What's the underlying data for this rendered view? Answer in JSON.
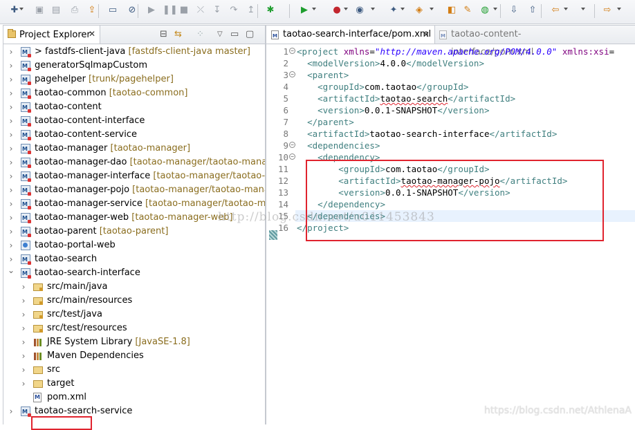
{
  "toolbar": {
    "icons": [
      "new-icon",
      "save-icon",
      "save-all-icon",
      "print-icon",
      "publish-icon",
      "console-icon",
      "skip-breakpoints-icon",
      "resume-icon",
      "suspend-icon",
      "terminate-icon",
      "disconnect-icon",
      "step-into-icon",
      "step-over-icon",
      "step-return-icon",
      "debug-icon",
      "run-icon",
      "run-external-icon",
      "coverage-icon",
      "new-java-class-icon",
      "open-type-icon",
      "open-task-icon",
      "search-icon",
      "web-browser-icon",
      "next-annotation-icon",
      "previous-annotation-icon",
      "back-icon",
      "forward-icon"
    ]
  },
  "project_explorer": {
    "title": "Project Explorer",
    "close": "✕",
    "items": [
      {
        "label": "> fastdfs-client-java",
        "decoration": "[fastdfs-client-java master]",
        "icon": "maven-project-icon",
        "expanded": false
      },
      {
        "label": "generatorSqlmapCustom",
        "decoration": "",
        "icon": "java-project-icon",
        "expanded": false
      },
      {
        "label": "pagehelper",
        "decoration": "[trunk/pagehelper]",
        "icon": "maven-project-icon",
        "expanded": false
      },
      {
        "label": "taotao-common",
        "decoration": "[taotao-common]",
        "icon": "maven-project-icon",
        "expanded": false
      },
      {
        "label": "taotao-content",
        "decoration": "",
        "icon": "maven-project-icon",
        "expanded": false
      },
      {
        "label": "taotao-content-interface",
        "decoration": "",
        "icon": "maven-project-icon",
        "expanded": false
      },
      {
        "label": "taotao-content-service",
        "decoration": "",
        "icon": "maven-project-icon",
        "expanded": false
      },
      {
        "label": "taotao-manager",
        "decoration": "[taotao-manager]",
        "icon": "maven-project-icon",
        "expanded": false
      },
      {
        "label": "taotao-manager-dao",
        "decoration": "[taotao-manager/taotao-manager-",
        "icon": "maven-project-icon",
        "expanded": false
      },
      {
        "label": "taotao-manager-interface",
        "decoration": "[taotao-manager/taotao-mana",
        "icon": "maven-project-icon",
        "expanded": false
      },
      {
        "label": "taotao-manager-pojo",
        "decoration": "[taotao-manager/taotao-manager",
        "icon": "maven-project-icon",
        "expanded": false
      },
      {
        "label": "taotao-manager-service",
        "decoration": "[taotao-manager/taotao-manag",
        "icon": "maven-project-icon",
        "expanded": false
      },
      {
        "label": "taotao-manager-web",
        "decoration": "[taotao-manager-web]",
        "icon": "maven-project-icon",
        "expanded": false
      },
      {
        "label": "taotao-parent",
        "decoration": "[taotao-parent]",
        "icon": "maven-project-icon",
        "expanded": false
      },
      {
        "label": "taotao-portal-web",
        "decoration": "",
        "icon": "web-project-icon",
        "expanded": false
      },
      {
        "label": "taotao-search",
        "decoration": "",
        "icon": "maven-project-icon",
        "expanded": false
      },
      {
        "label": "taotao-search-interface",
        "decoration": "",
        "icon": "maven-project-icon",
        "expanded": true
      },
      {
        "label": "src/main/java",
        "decoration": "",
        "icon": "package-folder-icon",
        "expanded": false,
        "child": true
      },
      {
        "label": "src/main/resources",
        "decoration": "",
        "icon": "package-folder-icon",
        "expanded": false,
        "child": true
      },
      {
        "label": "src/test/java",
        "decoration": "",
        "icon": "package-folder-icon",
        "expanded": false,
        "child": true
      },
      {
        "label": "src/test/resources",
        "decoration": "",
        "icon": "package-folder-icon",
        "expanded": false,
        "child": true
      },
      {
        "label": "JRE System Library",
        "decoration": "[JavaSE-1.8]",
        "icon": "library-icon",
        "expanded": false,
        "child": true
      },
      {
        "label": "Maven Dependencies",
        "decoration": "",
        "icon": "library-icon",
        "expanded": false,
        "child": true
      },
      {
        "label": "src",
        "decoration": "",
        "icon": "folder-icon",
        "expanded": false,
        "child": true
      },
      {
        "label": "target",
        "decoration": "",
        "icon": "folder-icon",
        "expanded": false,
        "child": true
      },
      {
        "label": "pom.xml",
        "decoration": "",
        "icon": "maven-pom-file-icon",
        "leaf": true,
        "child": true
      },
      {
        "label": "taotao-search-service",
        "decoration": "",
        "icon": "maven-project-icon",
        "expanded": false
      }
    ]
  },
  "editor": {
    "tabs": [
      {
        "label": "taotao-search-interface/pom.xml",
        "active": true,
        "close": "✕"
      },
      {
        "label": "taotao-content-interface/pom.xml",
        "active": false
      }
    ],
    "lines": [
      {
        "n": "1",
        "fold": "−",
        "html": [
          [
            "tag",
            "<"
          ],
          [
            "tn",
            "project"
          ],
          [
            "tx",
            " "
          ],
          [
            "an",
            "xmlns"
          ],
          [
            "tx",
            "="
          ],
          [
            "av",
            "\"http://maven.apache.org/POM/4.0.0\""
          ],
          [
            "tx",
            " "
          ],
          [
            "an",
            "xmlns:xsi"
          ],
          [
            "tx",
            "="
          ]
        ]
      },
      {
        "n": "2",
        "html": [
          [
            "tx",
            "  "
          ],
          [
            "tag",
            "<"
          ],
          [
            "tn",
            "modelVersion"
          ],
          [
            "tag",
            ">"
          ],
          [
            "tx",
            "4.0.0"
          ],
          [
            "tag",
            "</"
          ],
          [
            "tn",
            "modelVersion"
          ],
          [
            "tag",
            ">"
          ]
        ]
      },
      {
        "n": "3",
        "fold": "−",
        "html": [
          [
            "tx",
            "  "
          ],
          [
            "tag",
            "<"
          ],
          [
            "tn",
            "parent"
          ],
          [
            "tag",
            ">"
          ]
        ]
      },
      {
        "n": "4",
        "html": [
          [
            "tx",
            "    "
          ],
          [
            "tag",
            "<"
          ],
          [
            "tn",
            "groupId"
          ],
          [
            "tag",
            ">"
          ],
          [
            "tx",
            "com.taotao"
          ],
          [
            "tag",
            "</"
          ],
          [
            "tn",
            "groupId"
          ],
          [
            "tag",
            ">"
          ]
        ]
      },
      {
        "n": "5",
        "html": [
          [
            "tx",
            "    "
          ],
          [
            "tag",
            "<"
          ],
          [
            "tn",
            "artifactId"
          ],
          [
            "tag",
            ">"
          ],
          [
            "txw",
            "taotao-search"
          ],
          [
            "tag",
            "</"
          ],
          [
            "tn",
            "artifactId"
          ],
          [
            "tag",
            ">"
          ]
        ]
      },
      {
        "n": "6",
        "html": [
          [
            "tx",
            "    "
          ],
          [
            "tag",
            "<"
          ],
          [
            "tn",
            "version"
          ],
          [
            "tag",
            ">"
          ],
          [
            "tx",
            "0.0.1-SNAPSHOT"
          ],
          [
            "tag",
            "</"
          ],
          [
            "tn",
            "version"
          ],
          [
            "tag",
            ">"
          ]
        ]
      },
      {
        "n": "7",
        "html": [
          [
            "tx",
            "  "
          ],
          [
            "tag",
            "</"
          ],
          [
            "tn",
            "parent"
          ],
          [
            "tag",
            ">"
          ]
        ]
      },
      {
        "n": "8",
        "html": [
          [
            "tx",
            "  "
          ],
          [
            "tag",
            "<"
          ],
          [
            "tn",
            "artifactId"
          ],
          [
            "tag",
            ">"
          ],
          [
            "tx",
            "taotao-search-interface"
          ],
          [
            "tag",
            "</"
          ],
          [
            "tn",
            "artifactId"
          ],
          [
            "tag",
            ">"
          ]
        ]
      },
      {
        "n": "9",
        "fold": "−",
        "html": [
          [
            "tx",
            "  "
          ],
          [
            "tag",
            "<"
          ],
          [
            "tn",
            "dependencies"
          ],
          [
            "tag",
            ">"
          ]
        ]
      },
      {
        "n": "10",
        "fold": "−",
        "html": [
          [
            "tx",
            "    "
          ],
          [
            "tag",
            "<"
          ],
          [
            "tn",
            "dependency"
          ],
          [
            "tag",
            ">"
          ]
        ]
      },
      {
        "n": "11",
        "html": [
          [
            "tx",
            "        "
          ],
          [
            "tag",
            "<"
          ],
          [
            "tn",
            "groupId"
          ],
          [
            "tag",
            ">"
          ],
          [
            "tx",
            "com.taotao"
          ],
          [
            "tag",
            "</"
          ],
          [
            "tn",
            "groupId"
          ],
          [
            "tag",
            ">"
          ]
        ]
      },
      {
        "n": "12",
        "html": [
          [
            "tx",
            "        "
          ],
          [
            "tag",
            "<"
          ],
          [
            "tn",
            "artifactId"
          ],
          [
            "tag",
            ">"
          ],
          [
            "txw",
            "taotao-manager-pojo"
          ],
          [
            "tag",
            "</"
          ],
          [
            "tn",
            "artifactId"
          ],
          [
            "tag",
            ">"
          ]
        ]
      },
      {
        "n": "13",
        "html": [
          [
            "tx",
            "        "
          ],
          [
            "tag",
            "<"
          ],
          [
            "tn",
            "version"
          ],
          [
            "tag",
            ">"
          ],
          [
            "tx",
            "0.0.1-SNAPSHOT"
          ],
          [
            "tag",
            "</"
          ],
          [
            "tn",
            "version"
          ],
          [
            "tag",
            ">"
          ]
        ]
      },
      {
        "n": "14",
        "html": [
          [
            "tx",
            "    "
          ],
          [
            "tag",
            "</"
          ],
          [
            "tn",
            "dependency"
          ],
          [
            "tag",
            ">"
          ]
        ]
      },
      {
        "n": "15",
        "current": true,
        "html": [
          [
            "tx",
            "  "
          ],
          [
            "tag",
            "</"
          ],
          [
            "tn",
            "dependencies"
          ],
          [
            "tag",
            ">"
          ]
        ]
      },
      {
        "n": "16",
        "html": [
          [
            "tag",
            "</"
          ],
          [
            "tn",
            "project"
          ],
          [
            "tag",
            ">"
          ]
        ]
      }
    ]
  },
  "watermark": "http://blog.csdn.net/u011453843",
  "credit": "https://blog.csdn.net/AthlenaA",
  "colors": {
    "highlight_box": "#e0232e",
    "xml_tag": "#3f7f7f",
    "xml_attr": "#7f007f",
    "xml_value": "#2a00ff"
  }
}
